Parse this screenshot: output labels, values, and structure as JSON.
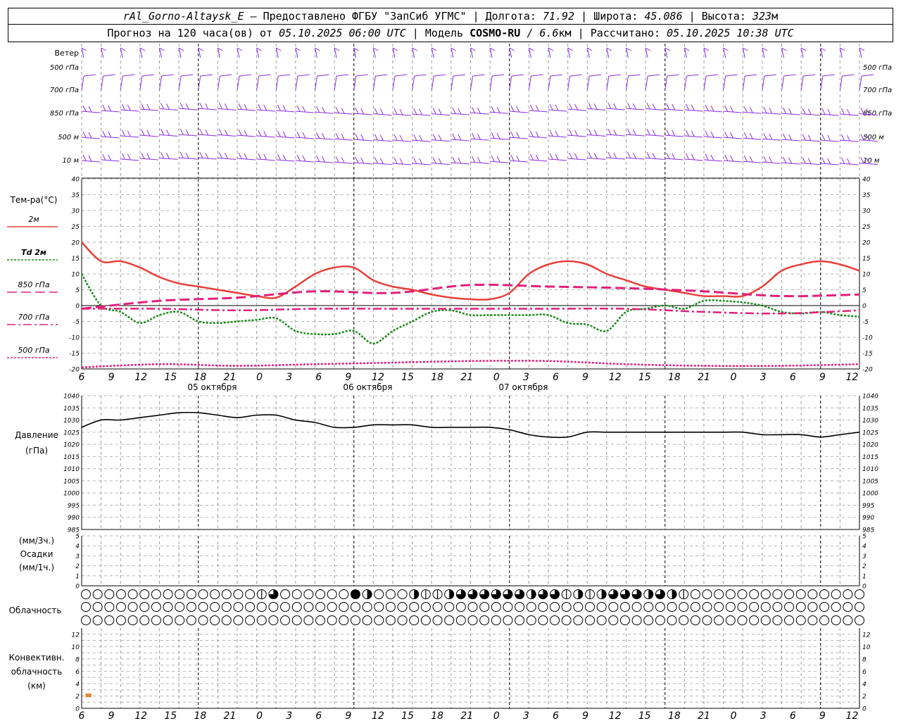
{
  "header": {
    "station": "rAl_Gorno-Altaysk_E",
    "dash": " – ",
    "provided_by": "Предоставлено ФГБУ \"ЗапСиб УГМС\"",
    "sep": " | ",
    "lon_label": "Долгота:",
    "lon_value": "71.92",
    "lat_label": "Широта:",
    "lat_value": "45.086",
    "alt_label": "Высота:",
    "alt_value": "323",
    "alt_unit": "м",
    "forecast_prefix": "Прогноз на 120 часа(ов) от ",
    "forecast_time": "05.10.2025 06:00 UTC",
    "model_label": "Модель",
    "model_name": "COSMO-RU",
    "model_res": " / 6.6",
    "model_res_unit": "км",
    "calc_label": "Рассчитано:",
    "calc_time": "05.10.2025 10:38 UTC"
  },
  "chart_data": {
    "type": "line",
    "x_ticks": [
      "6",
      "9",
      "12",
      "15",
      "18",
      "21",
      "0",
      "3",
      "6",
      "9",
      "12",
      "15",
      "18",
      "21",
      "0",
      "3",
      "6",
      "9",
      "12",
      "15",
      "18",
      "21",
      "0",
      "3",
      "6",
      "9",
      "12"
    ],
    "date_labels": [
      "05 октября",
      "06 октября",
      "07 октября"
    ],
    "wind": {
      "title": "Ветер",
      "levels": [
        "500 гПа",
        "700 гПа",
        "850 гПа",
        "500  м",
        "10  м"
      ],
      "color": "#8a2be2"
    },
    "temperature": {
      "title": "Тем-ра(°C)",
      "ylim": [
        -20,
        40
      ],
      "yticks": [
        40,
        35,
        30,
        25,
        20,
        15,
        10,
        5,
        0,
        -5,
        -10,
        -15,
        -20
      ],
      "legend": [
        "2м",
        "Td  2м",
        "850 гПа",
        "700 гПа",
        "500 гПа"
      ],
      "series": [
        {
          "name": "2м",
          "color": "#e8403a",
          "x": [
            0,
            1,
            2,
            3,
            4,
            5,
            6,
            7,
            8,
            9,
            10,
            11,
            12,
            13,
            14,
            15,
            16,
            17,
            18,
            19,
            20,
            21,
            22,
            23,
            24,
            25,
            26,
            27,
            28,
            29,
            30,
            31,
            32,
            33,
            34,
            35,
            36,
            37,
            38,
            39,
            40
          ],
          "y": [
            20,
            14,
            14,
            12,
            9,
            7,
            6,
            5,
            4,
            3,
            2.5,
            6,
            10,
            12,
            12,
            8,
            6,
            5,
            3.5,
            2.5,
            2,
            2,
            4,
            10,
            13,
            14,
            13,
            10,
            8,
            6,
            5,
            4,
            3,
            3,
            3,
            6,
            11,
            13,
            14,
            13,
            11
          ]
        },
        {
          "name": "Td  2м",
          "color": "#1a8a1a",
          "x": [
            0,
            1,
            2,
            3,
            4,
            5,
            6,
            7,
            8,
            9,
            10,
            11,
            12,
            13,
            14,
            15,
            16,
            17,
            18,
            19,
            20,
            21,
            22,
            23,
            24,
            25,
            26,
            27,
            28,
            29,
            30,
            31,
            32,
            33,
            34,
            35,
            36,
            37,
            38,
            39,
            40
          ],
          "y": [
            10,
            0,
            -2,
            -5.5,
            -3,
            -2,
            -5,
            -5.5,
            -5,
            -4.5,
            -4,
            -8,
            -9,
            -9,
            -8,
            -12,
            -8,
            -5,
            -2,
            -1.5,
            -3,
            -3,
            -3,
            -3,
            -3,
            -5.5,
            -6,
            -8,
            -2,
            -1,
            0,
            -1,
            1.5,
            1.5,
            1,
            0,
            -2,
            -2.5,
            -2,
            -3,
            -3.5
          ]
        },
        {
          "name": "850 гПа",
          "color": "#e0207a",
          "x": [
            0,
            4,
            8,
            12,
            16,
            20,
            24,
            28,
            32,
            36,
            40
          ],
          "y": [
            -1,
            1.5,
            2.5,
            4.5,
            4,
            6.5,
            6,
            5.5,
            4.5,
            3,
            3.5
          ]
        },
        {
          "name": "700 гПа",
          "color": "#e0207a",
          "x": [
            0,
            4,
            8,
            12,
            16,
            20,
            24,
            28,
            32,
            36,
            40
          ],
          "y": [
            -1,
            -1,
            -1.5,
            -1,
            -1,
            -1,
            -1,
            -1,
            -2,
            -2.5,
            -1.5
          ]
        },
        {
          "name": "500 гПа",
          "color": "#e0207a",
          "x": [
            0,
            4,
            8,
            12,
            16,
            20,
            24,
            28,
            32,
            36,
            40
          ],
          "y": [
            -19.5,
            -18.5,
            -19,
            -18.5,
            -18,
            -17.5,
            -17.5,
            -18.5,
            -19,
            -19,
            -18.5
          ]
        }
      ]
    },
    "pressure": {
      "title": "Давление",
      "unit": "(гПа)",
      "ylim": [
        985,
        1040
      ],
      "yticks": [
        1040,
        1035,
        1030,
        1025,
        1020,
        1015,
        1010,
        1005,
        1000,
        995,
        990,
        985
      ],
      "series": [
        {
          "name": "pressure",
          "color": "#000000",
          "x": [
            0,
            1,
            2,
            3,
            4,
            5,
            6,
            7,
            8,
            9,
            10,
            11,
            12,
            13,
            14,
            15,
            16,
            17,
            18,
            19,
            20,
            21,
            22,
            23,
            24,
            25,
            26,
            27,
            28,
            29,
            30,
            31,
            32,
            33,
            34,
            35,
            36,
            37,
            38,
            39,
            40
          ],
          "y": [
            1027,
            1030,
            1030,
            1031,
            1032,
            1033,
            1033,
            1032,
            1031,
            1032,
            1032,
            1030,
            1029,
            1027,
            1027,
            1028,
            1028,
            1028,
            1027,
            1027,
            1027,
            1027,
            1026,
            1024,
            1023,
            1023,
            1025,
            1025,
            1025,
            1025,
            1025,
            1025,
            1025,
            1025,
            1025,
            1024,
            1024,
            1024,
            1023,
            1024,
            1025
          ]
        }
      ]
    },
    "precipitation": {
      "label_top": "(мм/3ч.)",
      "title": "Осадки",
      "label_bottom": "(мм/1ч.)",
      "ylim": [
        0,
        5
      ],
      "yticks": [
        5,
        4,
        3,
        2,
        1,
        0
      ]
    },
    "clouds": {
      "title": "Облачность",
      "rows": 3,
      "count": 67,
      "row_levels": [
        [
          0,
          0,
          0,
          0,
          0,
          0,
          0,
          0,
          0,
          0,
          0,
          0,
          0,
          0,
          0,
          0,
          0,
          0,
          0,
          0,
          0,
          0,
          0,
          0,
          0,
          0,
          0,
          0,
          0,
          0,
          0,
          0,
          0,
          0,
          0,
          0,
          0,
          0,
          0,
          0,
          0,
          0,
          0,
          0,
          0,
          0,
          0,
          0,
          0,
          0,
          0,
          0,
          0,
          0,
          0,
          0,
          0,
          0,
          0,
          0,
          0,
          0,
          0,
          0,
          0,
          0,
          0
        ],
        [
          0,
          0,
          0,
          0,
          0,
          0,
          0,
          0,
          0,
          0,
          0,
          0,
          0,
          0,
          0,
          0,
          0,
          0,
          0,
          0,
          0,
          0,
          0,
          0,
          0,
          0,
          0,
          0,
          0,
          0,
          0,
          0,
          0,
          0,
          0,
          0,
          0,
          0,
          0,
          0,
          0,
          0,
          0,
          0,
          0,
          0,
          0,
          0,
          0,
          0,
          0,
          0,
          0,
          0,
          0,
          0,
          0,
          0,
          0,
          0,
          0,
          0,
          0,
          0,
          0,
          0,
          0
        ],
        [
          0,
          0,
          0,
          0,
          0,
          0,
          0,
          0,
          0,
          0,
          0,
          0,
          0,
          0,
          0,
          0,
          0,
          0,
          0,
          0,
          0,
          0,
          0,
          0,
          0,
          0,
          0,
          0,
          0,
          0,
          0,
          0,
          0,
          0,
          0,
          0,
          0,
          0,
          0,
          0,
          0,
          0,
          0,
          0,
          0,
          0,
          0,
          0,
          0,
          0,
          0,
          0,
          0,
          0,
          0,
          0,
          0,
          0,
          0,
          0,
          0,
          0,
          0,
          0,
          0,
          0,
          0
        ]
      ],
      "row0_overrides": {
        "15": 1,
        "16": 3,
        "23": 4,
        "24": 2,
        "28": 2,
        "29": 1,
        "30": 1,
        "31": 2,
        "32": 3,
        "33": 3,
        "34": 3,
        "35": 3,
        "36": 3,
        "37": 3,
        "38": 2,
        "39": 3,
        "40": 3,
        "41": 1,
        "42": 2,
        "43": 1,
        "44": 2,
        "45": 3,
        "46": 3,
        "47": 3,
        "48": 2,
        "49": 3,
        "50": 2,
        "51": 1
      }
    },
    "convective": {
      "title_1": "Конвективн.",
      "title_2": "облачность",
      "unit": "(км)",
      "ylim": [
        0,
        13
      ],
      "yticks": [
        12,
        10,
        8,
        6,
        4,
        2,
        0
      ],
      "bars": [
        {
          "x0": 0.2,
          "x1": 0.5,
          "bottom": 1.8,
          "top": 2.4,
          "color": "#e8862e"
        }
      ]
    }
  }
}
